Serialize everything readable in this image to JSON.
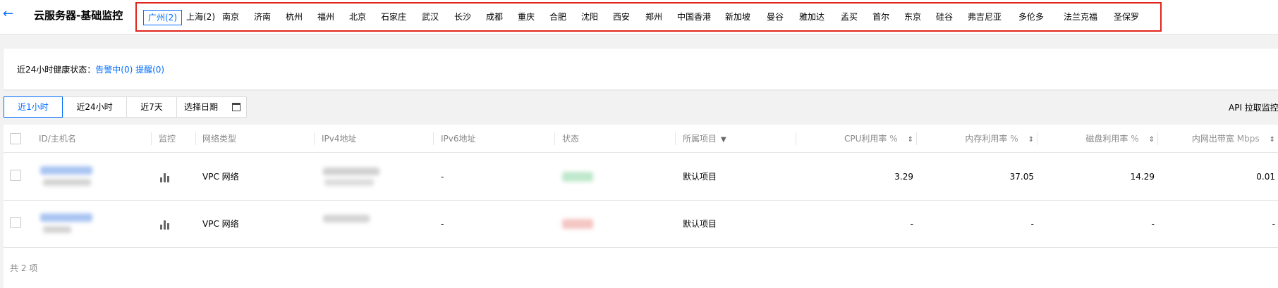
{
  "header": {
    "back_icon": "arrow-left-icon",
    "title": "云服务器-基础监控"
  },
  "regions": [
    {
      "label": "广州(2)",
      "active": true
    },
    {
      "label": "上海(2)"
    },
    {
      "label": "南京"
    },
    {
      "label": "济南"
    },
    {
      "label": "杭州"
    },
    {
      "label": "福州"
    },
    {
      "label": "北京"
    },
    {
      "label": "石家庄"
    },
    {
      "label": "武汉"
    },
    {
      "label": "长沙"
    },
    {
      "label": "成都"
    },
    {
      "label": "重庆"
    },
    {
      "label": "合肥"
    },
    {
      "label": "沈阳"
    },
    {
      "label": "西安"
    },
    {
      "label": "郑州"
    },
    {
      "label": "中国香港"
    },
    {
      "label": "新加坡"
    },
    {
      "label": "曼谷"
    },
    {
      "label": "雅加达"
    },
    {
      "label": "孟买"
    },
    {
      "label": "首尔"
    },
    {
      "label": "东京"
    },
    {
      "label": "硅谷"
    },
    {
      "label": "弗吉尼亚"
    },
    {
      "label": "多伦多"
    },
    {
      "label": "法兰克福"
    },
    {
      "label": "圣保罗"
    }
  ],
  "health": {
    "label": "近24小时健康状态：",
    "alarm": "告警中(0)",
    "reminder": "提醒(0)"
  },
  "time_range": {
    "buttons": [
      "近1小时",
      "近24小时",
      "近7天"
    ],
    "active_index": 0,
    "date_label": "选择日期",
    "date_icon": "calendar-icon"
  },
  "api_link": "API 拉取监控",
  "table": {
    "columns": {
      "id": "ID/主机名",
      "monitor": "监控",
      "network": "网络类型",
      "ipv4": "IPv4地址",
      "ipv6": "IPv6地址",
      "status": "状态",
      "project": "所属项目",
      "cpu": "CPU利用率",
      "mem": "内存利用率",
      "disk": "磁盘利用率",
      "bandwidth": "内网出带宽",
      "pct_unit": "%",
      "mbps_unit": "Mbps"
    },
    "icons": {
      "sort": "sort-icon",
      "filter": "filter-icon",
      "monitor": "bar-chart-icon"
    },
    "rows": [
      {
        "network": "VPC 网络",
        "ipv6": "-",
        "project": "默认项目",
        "cpu": "3.29",
        "mem": "37.05",
        "disk": "14.29",
        "bandwidth": "0.01",
        "status_color": "#2fc25b"
      },
      {
        "network": "VPC 网络",
        "ipv6": "-",
        "project": "默认项目",
        "cpu": "-",
        "mem": "-",
        "disk": "-",
        "bandwidth": "-",
        "status_color": "#f04134"
      }
    ]
  },
  "footer": {
    "total": "共 2 项"
  }
}
